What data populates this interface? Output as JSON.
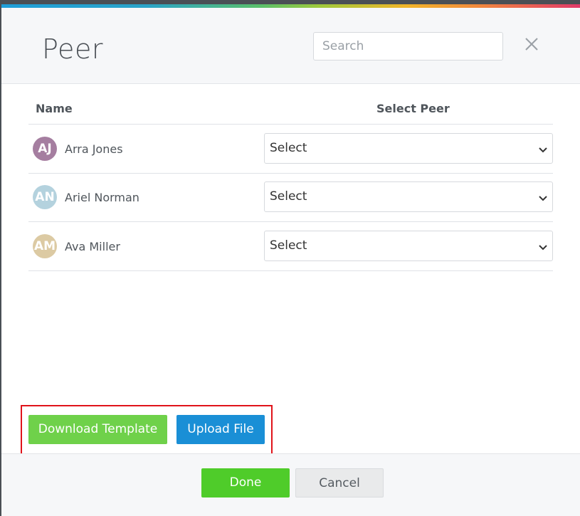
{
  "dialog": {
    "title": "Peer",
    "search_placeholder": "Search",
    "close_label": "close"
  },
  "table": {
    "headers": {
      "name": "Name",
      "select_peer": "Select Peer"
    },
    "rows": [
      {
        "initials": "AJ",
        "name": "Arra Jones",
        "avatar_color": "#a57ea0",
        "select_value": "Select"
      },
      {
        "initials": "AN",
        "name": "Ariel Norman",
        "avatar_color": "#b4d2de",
        "select_value": "Select"
      },
      {
        "initials": "AM",
        "name": "Ava Miller",
        "avatar_color": "#dccaa3",
        "select_value": "Select"
      }
    ]
  },
  "actions": {
    "download_template": "Download Template",
    "upload_file": "Upload File"
  },
  "footer": {
    "done": "Done",
    "cancel": "Cancel"
  },
  "colors": {
    "download_btn": "#6fd14a",
    "upload_btn": "#1a8fd6",
    "done_btn": "#4fcc2a",
    "highlight_box": "#e0131a"
  }
}
